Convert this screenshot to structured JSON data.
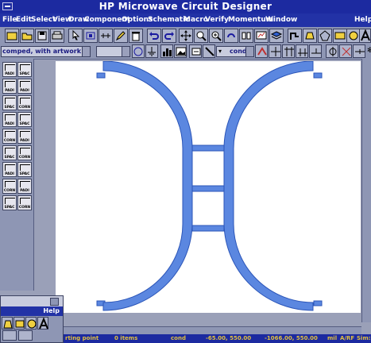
{
  "window": {
    "title": "HP Microwave Circuit Designer"
  },
  "menu": [
    "File",
    "Edit",
    "Select",
    "View",
    "Draw",
    "Component",
    "Options",
    "Schematic",
    "Macro",
    "Verify",
    "Momentum",
    "Window",
    "Help"
  ],
  "toolbar2": {
    "layer_combo": "comped, with artwork",
    "second_combo": "",
    "cond_combo": "cond"
  },
  "palette": {
    "items": [
      "PADI",
      "SPAC",
      "PADI",
      "PADI",
      "SPAC",
      "CORN",
      "PADI",
      "SPAC",
      "CORN",
      "PADI",
      "SPAC",
      "CORN",
      "PADI",
      "SPAC",
      "CORN",
      "PADI",
      "SPAC",
      "CORN"
    ]
  },
  "statusbar": {
    "mode": "rting point",
    "items": "0 items",
    "layer": "cond",
    "coord1": "-65.00, 550.00",
    "coord2": "-1066.00, 550.00",
    "units": "mil",
    "mode2": "A/RF",
    "sim": "Sim:S"
  },
  "floating": {
    "menu_label": "Help"
  },
  "colors": {
    "title_bar": "#1c2aa0",
    "menu_bar": "#2232a6",
    "trace_fill": "#5b87e0",
    "trace_stroke": "#2b55b8",
    "statusbar_text": "#e0c040"
  }
}
